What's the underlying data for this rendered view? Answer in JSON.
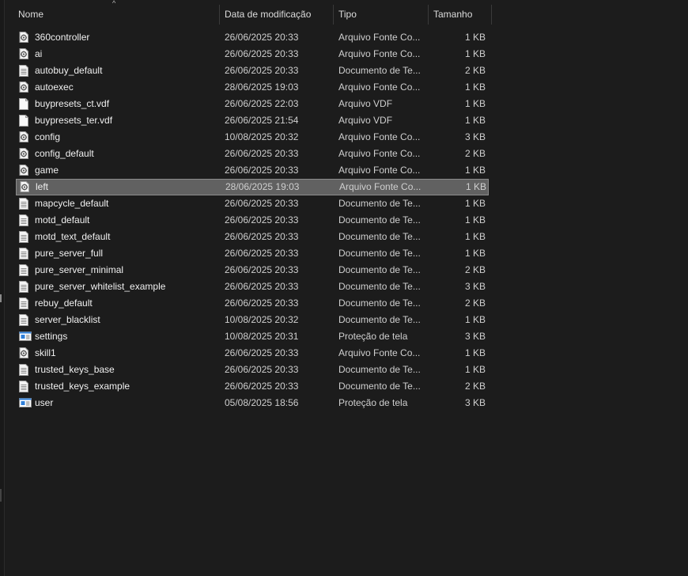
{
  "columns": {
    "name": "Nome",
    "date": "Data de modificação",
    "type": "Tipo",
    "size": "Tamanho",
    "sort_indicator": "^"
  },
  "files": [
    {
      "name": "360controller",
      "date": "26/06/2025 20:33",
      "type": "Arquivo Fonte Co...",
      "size": "1 KB",
      "icon": "gear-file-icon"
    },
    {
      "name": "ai",
      "date": "26/06/2025 20:33",
      "type": "Arquivo Fonte Co...",
      "size": "1 KB",
      "icon": "gear-file-icon"
    },
    {
      "name": "autobuy_default",
      "date": "26/06/2025 20:33",
      "type": "Documento de Te...",
      "size": "2 KB",
      "icon": "text-document-icon"
    },
    {
      "name": "autoexec",
      "date": "28/06/2025 19:03",
      "type": "Arquivo Fonte Co...",
      "size": "1 KB",
      "icon": "gear-file-icon"
    },
    {
      "name": "buypresets_ct.vdf",
      "date": "26/06/2025 22:03",
      "type": "Arquivo VDF",
      "size": "1 KB",
      "icon": "blank-file-icon"
    },
    {
      "name": "buypresets_ter.vdf",
      "date": "26/06/2025 21:54",
      "type": "Arquivo VDF",
      "size": "1 KB",
      "icon": "blank-file-icon"
    },
    {
      "name": "config",
      "date": "10/08/2025 20:32",
      "type": "Arquivo Fonte Co...",
      "size": "3 KB",
      "icon": "gear-file-icon"
    },
    {
      "name": "config_default",
      "date": "26/06/2025 20:33",
      "type": "Arquivo Fonte Co...",
      "size": "2 KB",
      "icon": "gear-file-icon"
    },
    {
      "name": "game",
      "date": "26/06/2025 20:33",
      "type": "Arquivo Fonte Co...",
      "size": "1 KB",
      "icon": "gear-file-icon"
    },
    {
      "name": "left",
      "date": "28/06/2025 19:03",
      "type": "Arquivo Fonte Co...",
      "size": "1 KB",
      "icon": "gear-file-icon",
      "selected": true
    },
    {
      "name": "mapcycle_default",
      "date": "26/06/2025 20:33",
      "type": "Documento de Te...",
      "size": "1 KB",
      "icon": "text-document-icon"
    },
    {
      "name": "motd_default",
      "date": "26/06/2025 20:33",
      "type": "Documento de Te...",
      "size": "1 KB",
      "icon": "text-document-icon"
    },
    {
      "name": "motd_text_default",
      "date": "26/06/2025 20:33",
      "type": "Documento de Te...",
      "size": "1 KB",
      "icon": "text-document-icon"
    },
    {
      "name": "pure_server_full",
      "date": "26/06/2025 20:33",
      "type": "Documento de Te...",
      "size": "1 KB",
      "icon": "text-document-icon"
    },
    {
      "name": "pure_server_minimal",
      "date": "26/06/2025 20:33",
      "type": "Documento de Te...",
      "size": "2 KB",
      "icon": "text-document-icon"
    },
    {
      "name": "pure_server_whitelist_example",
      "date": "26/06/2025 20:33",
      "type": "Documento de Te...",
      "size": "3 KB",
      "icon": "text-document-icon"
    },
    {
      "name": "rebuy_default",
      "date": "26/06/2025 20:33",
      "type": "Documento de Te...",
      "size": "2 KB",
      "icon": "text-document-icon"
    },
    {
      "name": "server_blacklist",
      "date": "10/08/2025 20:32",
      "type": "Documento de Te...",
      "size": "1 KB",
      "icon": "text-document-icon"
    },
    {
      "name": "settings",
      "date": "10/08/2025 20:31",
      "type": "Proteção de tela",
      "size": "3 KB",
      "icon": "screensaver-icon"
    },
    {
      "name": "skill1",
      "date": "26/06/2025 20:33",
      "type": "Arquivo Fonte Co...",
      "size": "1 KB",
      "icon": "gear-file-icon"
    },
    {
      "name": "trusted_keys_base",
      "date": "26/06/2025 20:33",
      "type": "Documento de Te...",
      "size": "1 KB",
      "icon": "text-document-icon"
    },
    {
      "name": "trusted_keys_example",
      "date": "26/06/2025 20:33",
      "type": "Documento de Te...",
      "size": "2 KB",
      "icon": "text-document-icon"
    },
    {
      "name": "user",
      "date": "05/08/2025 18:56",
      "type": "Proteção de tela",
      "size": "3 KB",
      "icon": "screensaver-icon"
    }
  ],
  "colors": {
    "background": "#1c1c1c",
    "selected_row": "#616161",
    "text": "#e6e6e6",
    "screensaver_accent": "#2f7fd8"
  }
}
